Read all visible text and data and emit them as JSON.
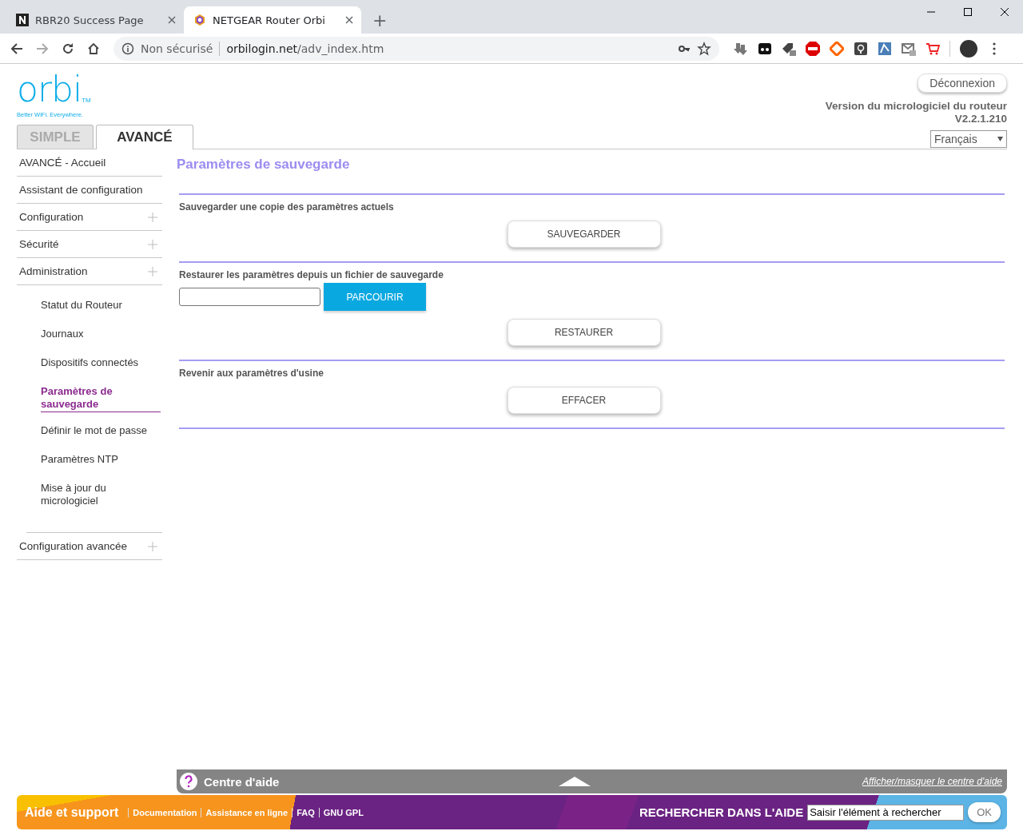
{
  "browser": {
    "tabs": [
      {
        "title": "RBR20 Success Page",
        "selected": false
      },
      {
        "title": "NETGEAR Router Orbi",
        "selected": true
      }
    ],
    "new_tab": "+",
    "address": {
      "security": "Non sécurisé",
      "host": "orbilogin.net",
      "path": "/adv_index.htm"
    }
  },
  "header": {
    "logo": "orbi",
    "trademark": "TM",
    "tagline": "Better WiFi. Everywhere.",
    "logout": "Déconnexion",
    "firmware_label": "Version du micrologiciel du routeur",
    "firmware_version": "V2.2.1.210",
    "language": "Français"
  },
  "mode_tabs": [
    {
      "label": "SIMPLE",
      "selected": false
    },
    {
      "label": "AVANCÉ",
      "selected": true
    }
  ],
  "sidebar": {
    "items": [
      {
        "label": "AVANCÉ - Accueil",
        "kind": "link"
      },
      {
        "label": "Assistant de configuration",
        "kind": "link"
      },
      {
        "label": "Configuration",
        "kind": "group"
      },
      {
        "label": "Sécurité",
        "kind": "group"
      },
      {
        "label": "Administration",
        "kind": "group",
        "children": [
          {
            "label": "Statut du Routeur",
            "selected": false
          },
          {
            "label": "Journaux",
            "selected": false
          },
          {
            "label": "Dispositifs connectés",
            "selected": false
          },
          {
            "label": "Paramètres de sauvegarde",
            "selected": true
          },
          {
            "label": "Définir le mot de passe",
            "selected": false
          },
          {
            "label": "Paramètres NTP",
            "selected": false
          },
          {
            "label": "Mise à jour du micrologiciel",
            "selected": false
          }
        ]
      },
      {
        "label": "Configuration avancée",
        "kind": "group"
      }
    ]
  },
  "content": {
    "title": "Paramètres de sauvegarde",
    "sections": [
      {
        "label": "Sauvegarder une copie des paramètres actuels",
        "button": "SAUVEGARDER"
      },
      {
        "label": "Restaurer les paramètres depuis un fichier de sauvegarde",
        "browse": "PARCOURIR",
        "button": "RESTAURER"
      },
      {
        "label": "Revenir aux paramètres d'usine",
        "button": "EFFACER"
      }
    ]
  },
  "help_bar": {
    "title": "Centre d'aide",
    "toggle": "Afficher/masquer le centre d'aide"
  },
  "footer": {
    "title": "Aide et support",
    "links": [
      "Documentation",
      "Assistance en ligne",
      "FAQ",
      "GNU GPL"
    ],
    "search_label": "RECHERCHER DANS L'AIDE",
    "search_value": "Saisir l'élément à rechercher",
    "ok": "OK"
  }
}
